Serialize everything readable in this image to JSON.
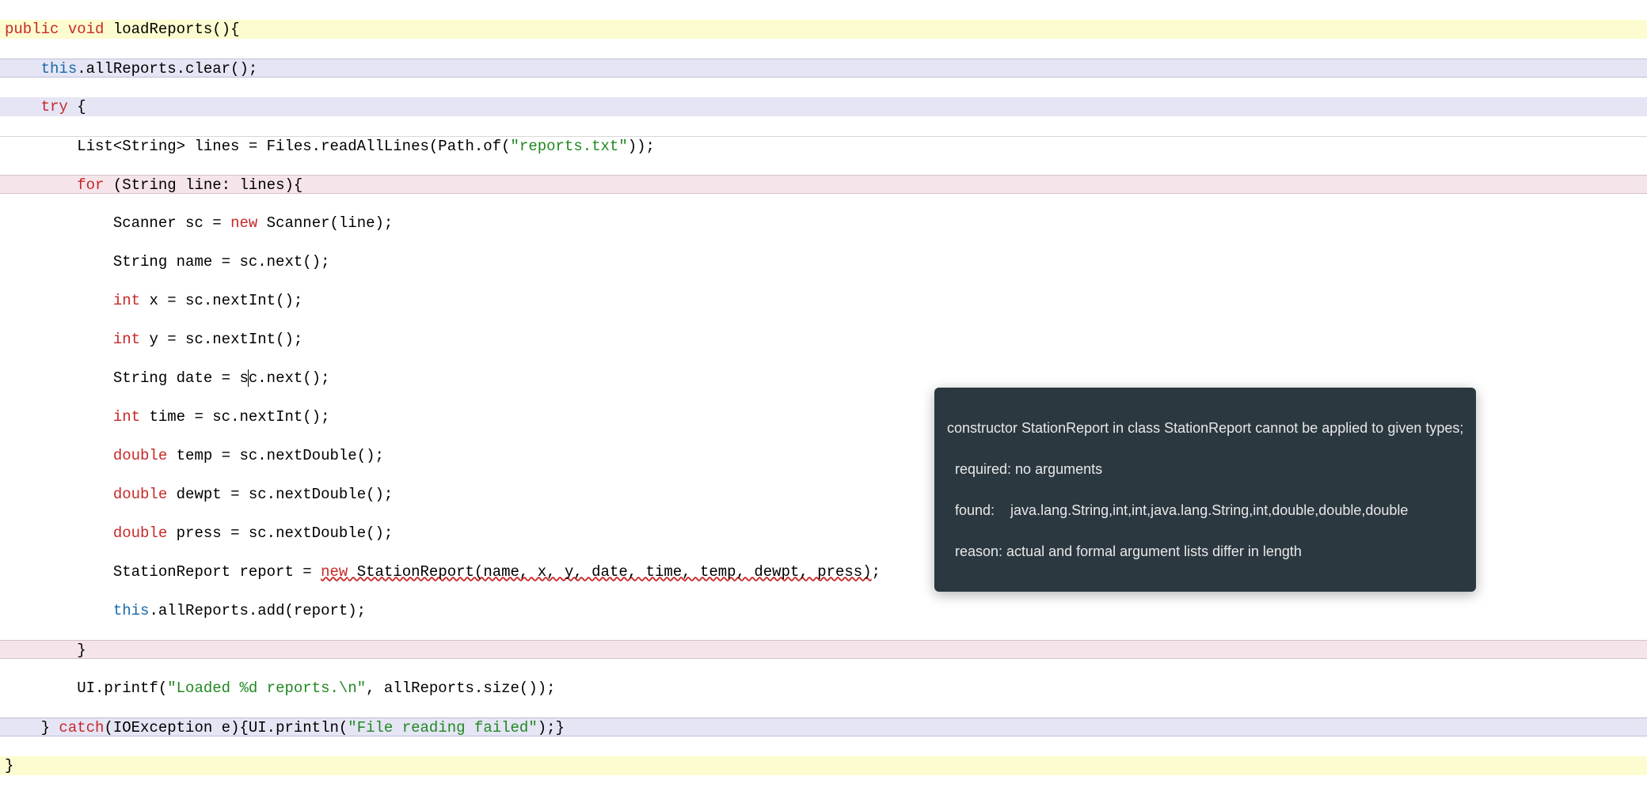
{
  "code": {
    "l1_public": "public",
    "l1_void": "void",
    "l1_method": " loadReports(){",
    "l2_indent": "    ",
    "l2_this": "this",
    "l2_rest": ".allReports.clear();",
    "l3_indent": "    ",
    "l3_try": "try",
    "l3_rest": " {",
    "l4_indent": "        ",
    "l4_text1": "List<String> lines = Files.readAllLines(Path.of(",
    "l4_str": "\"reports.txt\"",
    "l4_text2": "));",
    "l5_indent": "        ",
    "l5_for": "for",
    "l5_rest": " (String line: lines){",
    "l6_indent": "            ",
    "l6_text1": "Scanner sc = ",
    "l6_new": "new",
    "l6_text2": " Scanner(line);",
    "l7_indent": "            ",
    "l7_text": "String name = sc.next();",
    "l8_indent": "            ",
    "l8_int": "int",
    "l8_text": " x = sc.nextInt();",
    "l9_indent": "            ",
    "l9_int": "int",
    "l9_text": " y = sc.nextInt();",
    "l10_indent": "            ",
    "l10_text1": "String date = s",
    "l10_text2": "c.next();",
    "l11_indent": "            ",
    "l11_int": "int",
    "l11_text": " time = sc.nextInt();",
    "l12_indent": "            ",
    "l12_double": "double",
    "l12_text": " temp = sc.nextDouble();",
    "l13_indent": "            ",
    "l13_double": "double",
    "l13_text": " dewpt = sc.nextDouble();",
    "l14_indent": "            ",
    "l14_double": "double",
    "l14_text": " press = sc.nextDouble();",
    "l15_indent": "            ",
    "l15_text1": "StationReport report = ",
    "l15_new": "new",
    "l15_err": " StationReport(name, x, y, date, time, temp, dewpt, press)",
    "l15_text2": ";",
    "l16_indent": "            ",
    "l16_this": "this",
    "l16_text": ".allReports.add(report);",
    "l17_indent": "        ",
    "l17_text": "}",
    "l18_indent": "        ",
    "l18_text1": "UI.printf(",
    "l18_str": "\"Loaded %d reports.\\n\"",
    "l18_text2": ", allReports.size());",
    "l19_indent": "    ",
    "l19_text1": "} ",
    "l19_catch": "catch",
    "l19_text2": "(IOException e){UI.println(",
    "l19_str": "\"File reading failed\"",
    "l19_text3": ");}",
    "l20_text": "}"
  },
  "tooltip": {
    "line1": "constructor StationReport in class StationReport cannot be applied to given types;",
    "line2": "  required: no arguments",
    "line3": "  found:    java.lang.String,int,int,java.lang.String,int,double,double,double",
    "line4": "  reason: actual and formal argument lists differ in length"
  }
}
